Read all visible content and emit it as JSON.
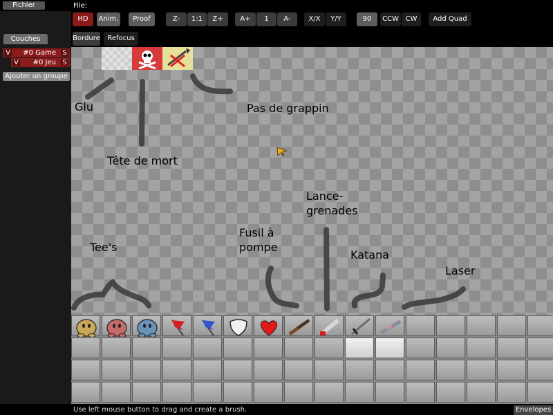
{
  "menu": {
    "fichier": "Fichier",
    "file_label": "File:"
  },
  "toolbar": {
    "row1": [
      {
        "name": "hd-button",
        "label": "HD"
      },
      {
        "name": "animation-button",
        "label": "Anim."
      },
      {
        "name": "proof-button",
        "label": "Proof"
      },
      {
        "name": "zoom-out-button",
        "label": "Z-"
      },
      {
        "name": "zoom-reset-button",
        "label": "1:1"
      },
      {
        "name": "zoom-in-button",
        "label": "Z+"
      },
      {
        "name": "speed-up-button",
        "label": "A+"
      },
      {
        "name": "speed-value",
        "label": "1"
      },
      {
        "name": "speed-down-button",
        "label": "A-"
      },
      {
        "name": "flip-x-button",
        "label": "X/X"
      },
      {
        "name": "flip-y-button",
        "label": "Y/Y"
      },
      {
        "name": "rotation-value",
        "label": "90"
      },
      {
        "name": "rotate-ccw-button",
        "label": "CCW"
      },
      {
        "name": "rotate-cw-button",
        "label": "CW"
      },
      {
        "name": "add-quad-button",
        "label": "Add Quad"
      }
    ],
    "row2": [
      {
        "name": "border-button",
        "label": "Bordure"
      },
      {
        "name": "refocus-button",
        "label": "Refocus"
      }
    ]
  },
  "layers": {
    "tab": "Couches",
    "rows": [
      {
        "v": "V",
        "name": "#0 Game",
        "s": "S"
      },
      {
        "v": "V",
        "name": "#0 Jeu",
        "s": "S"
      }
    ],
    "add_group": "Ajouter un groupe"
  },
  "canvas_labels": {
    "glu": "Glu",
    "no_hook": "Pas de grappin",
    "death": "Tête de mort",
    "grenade": "Lance-\ngrenades",
    "shotgun": "Fusil à\npompe",
    "katana": "Katana",
    "tees": "Tee's",
    "laser": "Laser"
  },
  "palette": {
    "row1": [
      {
        "name": "tee-yellow-tile",
        "icon": "tee-icon",
        "color": "#c9a75a"
      },
      {
        "name": "tee-red-tile",
        "icon": "tee-icon",
        "color": "#c46a6a"
      },
      {
        "name": "tee-blue-tile",
        "icon": "tee-icon",
        "color": "#6a93b8"
      },
      {
        "name": "red-flag-tile",
        "icon": "flag-icon",
        "color": "#d21f1f"
      },
      {
        "name": "blue-flag-tile",
        "icon": "flag-icon",
        "color": "#2f55c8"
      },
      {
        "name": "armor-tile",
        "icon": "shield-icon",
        "color": "#f0f0f0"
      },
      {
        "name": "health-tile",
        "icon": "heart-icon",
        "color": "#e11a1a"
      },
      {
        "name": "shotgun-tile",
        "icon": "shotgun-icon",
        "color": "#7a4a2a"
      },
      {
        "name": "grenade-tile",
        "icon": "grenade-launcher-icon",
        "color": "#d8d8d8"
      },
      {
        "name": "katana-tile",
        "icon": "katana-icon",
        "color": "#6a6a6a"
      },
      {
        "name": "laser-tile",
        "icon": "laser-rifle-icon",
        "color": "#8a8a9a"
      }
    ]
  },
  "status": {
    "text": "Use left mouse button to drag and create a brush.",
    "envelopes": "Envelopes"
  }
}
